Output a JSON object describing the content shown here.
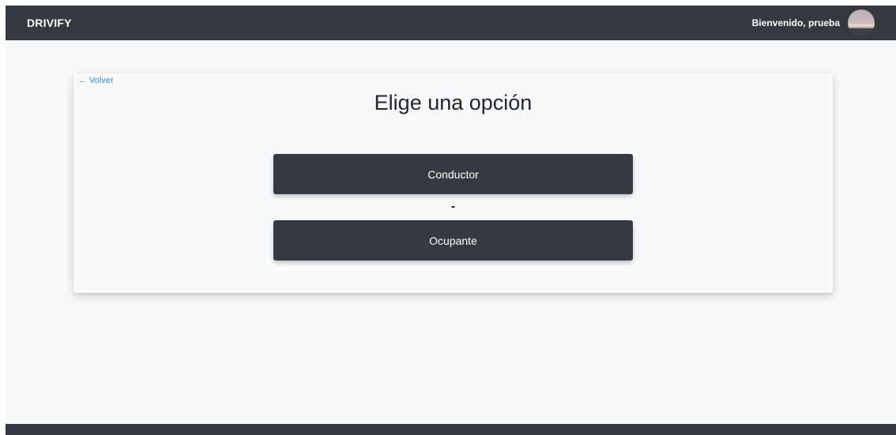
{
  "navbar": {
    "brand": "DRIVIFY",
    "welcome_text": "Bienvenido, prueba"
  },
  "card": {
    "back_link": "← Volver",
    "title": "Elige una opción",
    "options": [
      {
        "label": "Conductor"
      },
      {
        "label": "Ocupante"
      }
    ],
    "separator": "-"
  },
  "colors": {
    "navbar_bg": "#343a40",
    "page_bg": "#f8f9fa",
    "button_bg": "#343a40",
    "link": "#3b8ed0"
  },
  "icons": {
    "avatar": "user-avatar-photo"
  }
}
